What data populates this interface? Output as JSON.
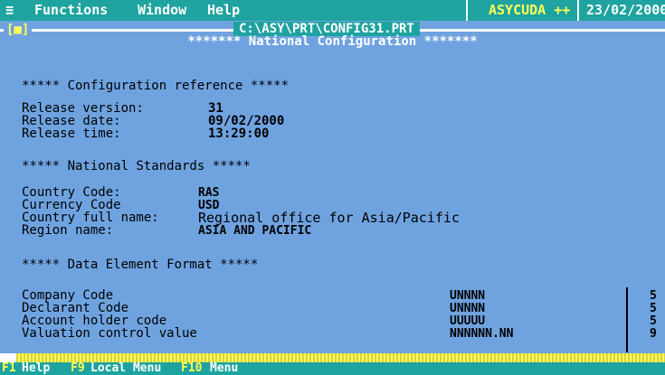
{
  "menubar": {
    "system_menu": "≡",
    "functions": "Functions",
    "window": "Window",
    "help": "Help",
    "app_name": "ASYCUDA ++",
    "date": "23/02/2000"
  },
  "window": {
    "close_box": "[■]",
    "path": "C:\\ASY\\PRT\\CONFIG31.PRT",
    "title": "******* National Configuration *******"
  },
  "sections": {
    "config_ref": "***** Configuration reference *****",
    "national_std": "***** National Standards *****",
    "data_elem": "***** Data Element Format *****"
  },
  "config_reference": {
    "release_version_label": "Release version:",
    "release_version": "31",
    "release_date_label": "Release date:",
    "release_date": "09/02/2000",
    "release_time_label": "Release time:",
    "release_time": "13:29:00"
  },
  "national_standards": {
    "country_code_label": "Country Code:",
    "country_code": "RAS",
    "currency_code_label": "Currency Code",
    "currency_code": "USD",
    "country_full_name_label": "Country full name:",
    "country_full_name": "Regional office for Asia/Pacific",
    "region_name_label": "Region name:",
    "region_name": "ASIA AND PACIFIC"
  },
  "data_element_format": {
    "rows": [
      {
        "name": "Company Code",
        "format": "UNNNN",
        "length": "5"
      },
      {
        "name": "Declarant Code",
        "format": "UNNNN",
        "length": "5"
      },
      {
        "name": "Account holder code",
        "format": "UUUUU",
        "length": "5"
      },
      {
        "name": "Valuation control value",
        "format": "NNNNNN.NN",
        "length": "9"
      }
    ]
  },
  "statusbar": {
    "f1_key": "F1",
    "f1_label": "Help",
    "f9_key": "F9",
    "f9_label": "Local Menu",
    "f10_key": "F10",
    "f10_label": "Menu"
  },
  "colors": {
    "background": "#6fa3e0",
    "menubar": "#1ea3a0",
    "accent_yellow": "#ffff55"
  }
}
